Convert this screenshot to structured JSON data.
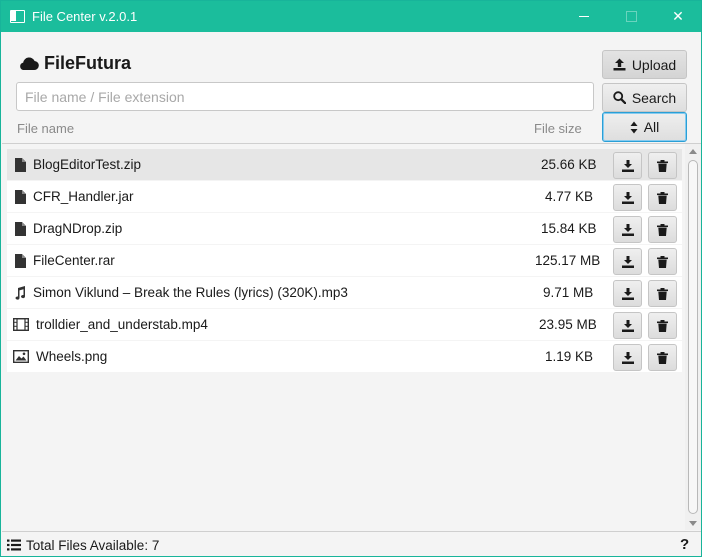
{
  "window": {
    "title": "File Center v.2.0.1",
    "accent_color": "#1bbd9c",
    "close_glyph": "✕"
  },
  "brand": {
    "name": "FileFutura",
    "icon": "cloud-icon"
  },
  "toolbar": {
    "upload_label": "Upload",
    "search_label": "Search",
    "filter_label": "All"
  },
  "search": {
    "placeholder": "File name / File extension",
    "value": ""
  },
  "table": {
    "headers": {
      "name": "File name",
      "size": "File size"
    },
    "rows": [
      {
        "name": "BlogEditorTest.zip",
        "size": "25.66 KB",
        "icon": "file-icon",
        "selected": true
      },
      {
        "name": "CFR_Handler.jar",
        "size": "4.77 KB",
        "icon": "file-icon",
        "selected": false
      },
      {
        "name": "DragNDrop.zip",
        "size": "15.84 KB",
        "icon": "file-icon",
        "selected": false
      },
      {
        "name": "FileCenter.rar",
        "size": "125.17 MB",
        "icon": "file-icon",
        "selected": false
      },
      {
        "name": "Simon Viklund – Break the Rules (lyrics) (320K).mp3",
        "size": "9.71 MB",
        "icon": "music-icon",
        "selected": false
      },
      {
        "name": "trolldier_and_understab.mp4",
        "size": "23.95 MB",
        "icon": "film-icon",
        "selected": false
      },
      {
        "name": "Wheels.png",
        "size": "1.19 KB",
        "icon": "image-icon",
        "selected": false
      }
    ]
  },
  "status": {
    "text": "Total Files Available: 7",
    "help_label": "?"
  }
}
